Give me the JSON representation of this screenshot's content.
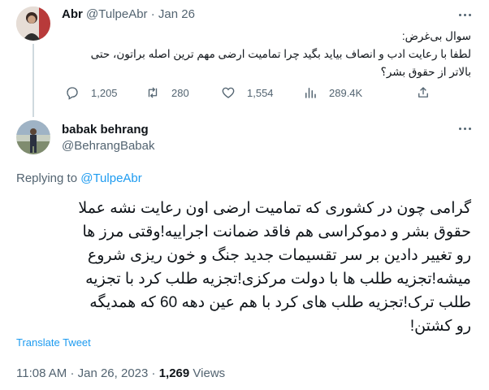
{
  "quoted_tweet": {
    "author_name": "Abr",
    "author_handle": "@TulpeAbr",
    "separator": "·",
    "date": "Jan 26",
    "text_line1": "سوال بی‌غرض:",
    "text_line2": "لطفا با رعایت ادب و انصاف بیاید بگید چرا تمامیت ارضی مهم ترین اصله براتون، حتی",
    "text_line3": "بالاتر از حقوق بشر؟",
    "actions": {
      "replies": "1,205",
      "retweets": "280",
      "likes": "1,554",
      "views": "289.4K"
    }
  },
  "main_tweet": {
    "author_name": "babak behrang",
    "author_handle": "@BehrangBabak",
    "replying_prefix": "Replying to",
    "replying_to": "@TulpeAbr",
    "text_lines": [
      "گرامی چون در کشوری که تمامیت ارضی اون رعایت نشه عملا",
      "حقوق بشر و دموکراسی هم فاقد ضمانت اجراییه!وقتی مرز ها",
      "رو تغییر دادین بر سر تقسیمات جدید جنگ و خون ریزی شروع",
      "میشه!تجزیه طلب ها با دولت مرکزی!تجزیه طلب کرد با تجزیه",
      "طلب ترک!تجزیه طلب های کرد با هم عین دهه 60 که همدیگه",
      "رو کشتن!"
    ],
    "translate_label": "Translate Tweet",
    "time": "11:08 AM",
    "separator": "·",
    "date": "Jan 26, 2023",
    "separator2": "·",
    "views_count": "1,269",
    "views_label": "Views"
  },
  "colors": {
    "link": "#1d9bf0",
    "muted": "#536471",
    "text": "#0f1419",
    "thread_line": "#cfd9de"
  }
}
